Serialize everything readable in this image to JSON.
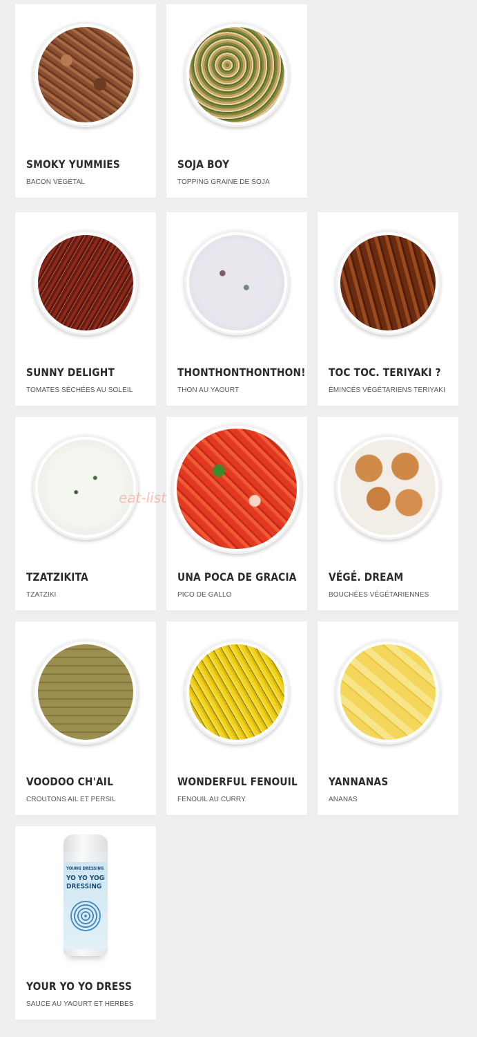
{
  "products": [
    {
      "name": "SMOKY YUMMIES",
      "desc": "BACON VÉGÉTAL",
      "image": "bacon-bowl-image"
    },
    {
      "name": "SOJA BOY",
      "desc": "TOPPING GRAINE DE SOJA",
      "image": "seeds-bowl-image"
    },
    {
      "name": "SUNNY DELIGHT",
      "desc": "TOMATES SÉCHÉES AU SOLEIL",
      "image": "dried-tomato-bowl-image"
    },
    {
      "name": "THONTHONTHONTHON!",
      "desc": "THON AU YAOURT",
      "image": "tuna-yogurt-bowl-image"
    },
    {
      "name": "TOC TOC. TERIYAKI ?",
      "desc": "ÉMINCÉS VÉGÉTARIENS TERIYAKI",
      "image": "teriyaki-bowl-image"
    },
    {
      "name": "TZATZIKITA",
      "desc": "TZATZIKI",
      "image": "tzatziki-bowl-image"
    },
    {
      "name": "UNA POCA DE GRACIA",
      "desc": "PICO DE GALLO",
      "image": "pico-de-gallo-bowl-image"
    },
    {
      "name": "VÉGÉ. DREAM",
      "desc": "BOUCHÉES VÉGÉTARIENNES",
      "image": "veggie-balls-bowl-image"
    },
    {
      "name": "VOODOO CH'AIL",
      "desc": "CROUTONS AIL ET PERSIL",
      "image": "croutons-bowl-image"
    },
    {
      "name": "WONDERFUL FENOUIL",
      "desc": "FENOUIL AU CURRY",
      "image": "fennel-bowl-image"
    },
    {
      "name": "YANNANAS",
      "desc": "ANANAS",
      "image": "pineapple-bowl-image"
    },
    {
      "name": "YOUR YO YO DRESS",
      "desc": "SAUCE AU YAOURT ET HERBES",
      "image": "dressing-bottle-image"
    }
  ],
  "bottle_label": {
    "brand": "YOUNG DRESSING",
    "line1": "YO YO YOGHURT",
    "line2": "DRESSING"
  },
  "watermark": "eat-list"
}
